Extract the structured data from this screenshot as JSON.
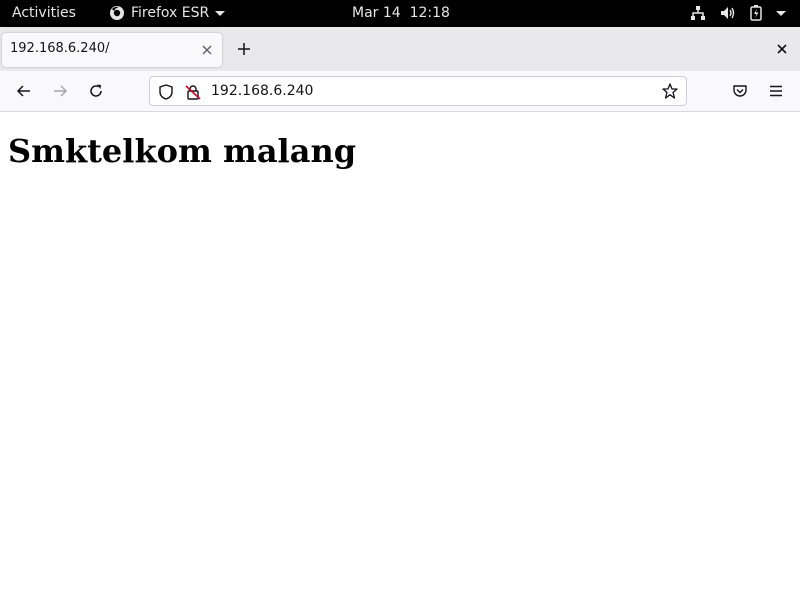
{
  "topbar": {
    "activities": "Activities",
    "app_name": "Firefox ESR",
    "clock": "Mar 14  12:18",
    "icons": [
      "network-icon",
      "volume-icon",
      "battery-icon",
      "system-menu-caret-icon"
    ]
  },
  "browser": {
    "tab": {
      "title": "192.168.6.240/"
    },
    "url": "192.168.6.240",
    "accent_color": "#15141a"
  },
  "page": {
    "heading": "Smktelkom malang"
  }
}
